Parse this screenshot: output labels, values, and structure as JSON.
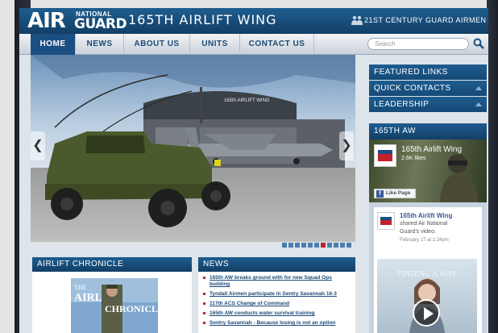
{
  "header": {
    "logo_air": "AIR",
    "logo_national": "NATIONAL",
    "logo_guard": "GUARD",
    "site_title": "165TH AIRLIFT WING",
    "airmen_link": "21ST CENTURY GUARD AIRMEN",
    "airmen_icon": "people-icon"
  },
  "nav": {
    "items": [
      {
        "label": "HOME",
        "active": true
      },
      {
        "label": "NEWS",
        "active": false
      },
      {
        "label": "ABOUT US",
        "active": false
      },
      {
        "label": "UNITS",
        "active": false
      },
      {
        "label": "CONTACT US",
        "active": false
      }
    ],
    "search_placeholder": "Search",
    "search_icon": "search-icon"
  },
  "hero": {
    "hangar_sign": "165th AIRLIFT WING",
    "prev_icon": "chevron-left-icon",
    "next_icon": "chevron-right-icon",
    "prev_glyph": "❮",
    "next_glyph": "❯",
    "slide_count": 11,
    "active_slide": 6
  },
  "chronicle": {
    "heading": "AIRLIFT CHRONICLE",
    "cover_word1": "THE",
    "cover_word2": "AIRLIFT",
    "cover_word3": "CHRONICLE"
  },
  "news": {
    "heading": "NEWS",
    "items": [
      "165th AW breaks ground with for new Squad Ops building",
      "Tyndall Airmen participate in Sentry Savannah 16-3",
      "117th ACS Change of Command",
      "165th AW conducts water survival training",
      "Sentry Savannah - Because losing is not an option"
    ]
  },
  "sidebar": {
    "links": [
      {
        "label": "FEATURED LINKS",
        "expandable": false
      },
      {
        "label": "QUICK CONTACTS",
        "expandable": true
      },
      {
        "label": "LEADERSHIP",
        "expandable": true
      }
    ],
    "aw_heading": "165TH AW",
    "facebook": {
      "page_name": "165th Airlift Wing",
      "likes": "2.6K likes",
      "like_button": "Like Page",
      "post_page": "165th Airlift Wing",
      "post_shared": "shared Air National",
      "post_shared2": "Guard's video.",
      "post_date": "February 17 at 1:24pm",
      "video_text": "FINDING A WAY",
      "play_icon": "play-icon"
    }
  },
  "colors": {
    "primary": "#1c4f81",
    "header_dark": "#123f66",
    "accent_red": "#c0212b",
    "dot_active": "#c0212b",
    "dot_inactive": "#4a7cb0"
  }
}
